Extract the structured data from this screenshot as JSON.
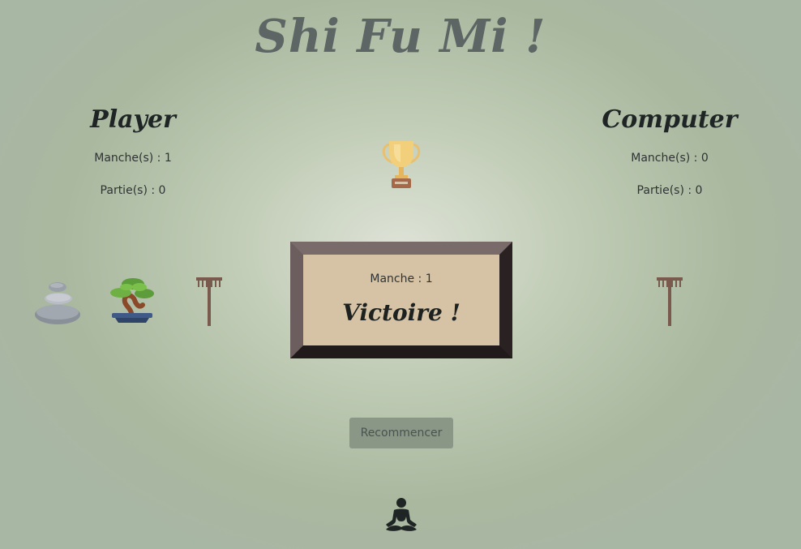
{
  "title": "Shi Fu Mi !",
  "player": {
    "name": "Player",
    "rounds_label": "Manche(s) : 1",
    "games_label": "Partie(s) : 0"
  },
  "computer": {
    "name": "Computer",
    "rounds_label": "Manche(s) : 0",
    "games_label": "Partie(s) : 0"
  },
  "board": {
    "round_label": "Manche : 1",
    "result": "Victoire !"
  },
  "restart_label": "Recommencer",
  "icons": {
    "trophy": "trophy-icon",
    "player_choices": [
      "stones-icon",
      "bonsai-icon",
      "rake-icon"
    ],
    "computer_choice": "rake-icon",
    "footer": "meditation-icon"
  },
  "colors": {
    "title": "#5d6664",
    "board_bg": "#d6c2a4",
    "board_frame": "#2a2122",
    "button_bg": "#8a9686",
    "button_text": "#495350"
  }
}
